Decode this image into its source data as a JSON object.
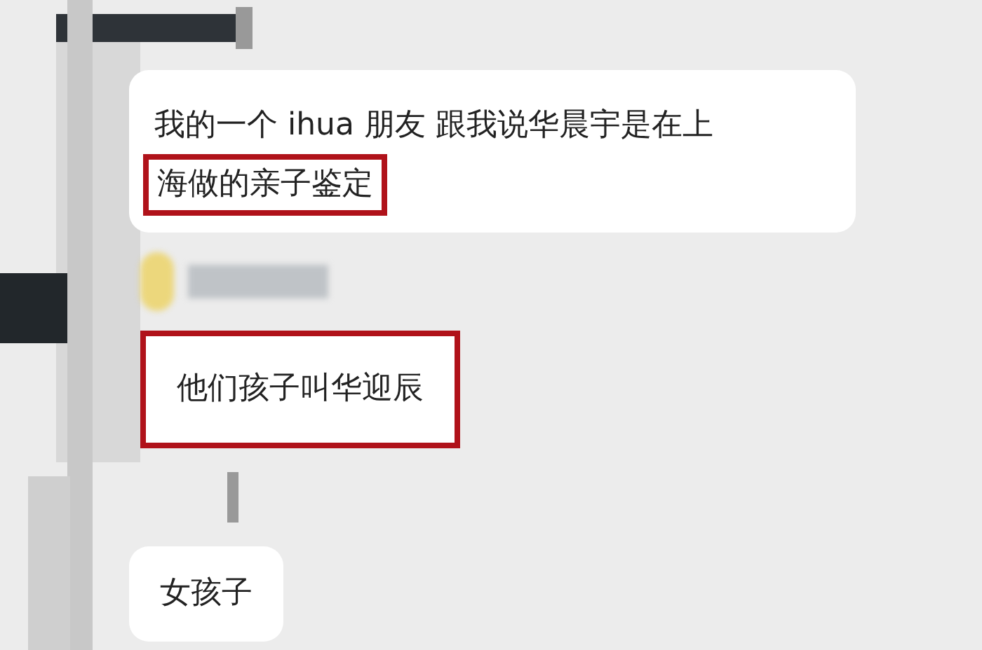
{
  "messages": [
    {
      "highlighted": false,
      "lines": [
        {
          "text": "我的一个 ihua 朋友 跟我说华晨宇是在上",
          "highlighted": false
        },
        {
          "text": "海做的亲子鉴定",
          "highlighted": true
        }
      ]
    },
    {
      "kind": "sender"
    },
    {
      "highlighted": true,
      "lines": [
        {
          "text": "他们孩子叫华迎辰",
          "highlighted": false
        }
      ]
    },
    {
      "kind": "gap"
    },
    {
      "highlighted": false,
      "lines": [
        {
          "text": "女孩子",
          "highlighted": false
        }
      ]
    }
  ]
}
